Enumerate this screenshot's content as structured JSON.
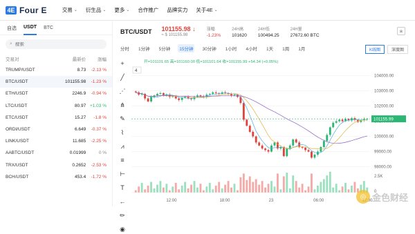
{
  "nav": {
    "logo_mark": "4E",
    "logo_text": "Four E",
    "items": [
      {
        "label": "交易",
        "caret": true
      },
      {
        "label": "衍生品",
        "caret": true
      },
      {
        "label": "更多",
        "caret": true
      },
      {
        "label": "合作推广",
        "caret": false
      },
      {
        "label": "品牌实力",
        "caret": false
      },
      {
        "label": "关于4E",
        "caret": true
      }
    ]
  },
  "market": {
    "tabs": [
      "自选",
      "USDT",
      "BTC"
    ],
    "active_tab": "USDT",
    "search_placeholder": "搜索",
    "headers": {
      "pair": "交易对",
      "price": "最新价",
      "change": "涨幅"
    },
    "rows": [
      {
        "pair": "TRUMP/USDT",
        "price": "8.73",
        "change": "-2.13 %",
        "dir": "down"
      },
      {
        "pair": "BTC/USDT",
        "price": "101155.98",
        "change": "-1.23 %",
        "dir": "down"
      },
      {
        "pair": "ETH/USDT",
        "price": "2246.9",
        "change": "-0.94 %",
        "dir": "down"
      },
      {
        "pair": "LTC/USDT",
        "price": "80.97",
        "change": "+1.03 %",
        "dir": "up"
      },
      {
        "pair": "ETC/USDT",
        "price": "15.27",
        "change": "-1.8 %",
        "dir": "down"
      },
      {
        "pair": "ORDI/USDT",
        "price": "6.649",
        "change": "-0.37 %",
        "dir": "down"
      },
      {
        "pair": "LINK/USDT",
        "price": "11.685",
        "change": "-2.25 %",
        "dir": "down"
      },
      {
        "pair": "AABTC/USDT",
        "price": "0.01999",
        "change": "0 %",
        "dir": "flat"
      },
      {
        "pair": "TRX/USDT",
        "price": "0.2652",
        "change": "-2.53 %",
        "dir": "down"
      },
      {
        "pair": "BCH/USDT",
        "price": "453.4",
        "change": "-1.72 %",
        "dir": "down"
      }
    ]
  },
  "ticker": {
    "pair": "BTC/USDT",
    "price": "101155.98",
    "arrow": "↓",
    "price_usd": "≈ $ 101155.98",
    "change_label": "涨幅",
    "change_value": "-1.23%",
    "high_label": "24H高",
    "high_value": "101620",
    "low_label": "24H低",
    "low_value": "100494.25",
    "vol_label": "24H量",
    "vol_value": "27672.60 BTC"
  },
  "intervals": [
    "分时",
    "1分钟",
    "5分钟",
    "15分钟",
    "30分钟",
    "1小时",
    "4小时",
    "1天",
    "1周",
    "1月"
  ],
  "active_interval": "15分钟",
  "chart_modes": [
    "K线图",
    "深度图"
  ],
  "active_mode": "K线图",
  "tools": [
    "crosshair-tool",
    "trendline-tool",
    "ray-tool",
    "fork-tool",
    "brush-tool",
    "ruler-tool",
    "pattern-tool",
    "fib-tool",
    "measure-tool",
    "text-tool",
    "back-tool",
    "pencil-tool",
    "eye-tool"
  ],
  "chart_data": {
    "type": "candlestick",
    "ohlc_legend": "开=101101.65  高=101160.00  低=101101.64  收=101155.99  +54.34 (+0.05%)",
    "indicator_count": "4",
    "last_price_label": "101155.99",
    "y_ticks": [
      "104000.00",
      "103000.00",
      "102000.00",
      "101000.00",
      "100000.00",
      "99000.00",
      "98000.00"
    ],
    "ylim": [
      97800,
      104300
    ],
    "x_ticks": [
      "12:00",
      "18:00",
      "23",
      "06:00",
      "12:00"
    ],
    "volume_ticks": [
      "2.5K",
      "0"
    ],
    "closes": [
      102900,
      102750,
      102800,
      102500,
      102300,
      102600,
      102700,
      102800,
      102850,
      102700,
      102750,
      102600,
      102650,
      102500,
      102400,
      102550,
      102600,
      102500,
      102450,
      102600,
      102700,
      102650,
      102600,
      102750,
      102800,
      102900,
      102850,
      102800,
      102900,
      102850,
      102800,
      102700,
      102750,
      102600,
      102200,
      101100,
      100700,
      100300,
      100000,
      99600,
      99400,
      99200,
      99100,
      99000,
      99400,
      99600,
      99200,
      99300,
      98700,
      99200,
      99400,
      99800,
      99600,
      99300,
      99250,
      99100,
      99000,
      98600,
      98800,
      99000,
      99300,
      99700,
      100100,
      100600,
      100900,
      101000,
      101100,
      101000,
      101150,
      101050,
      101200,
      101100,
      100950,
      101050,
      101150,
      101155
    ]
  }
}
